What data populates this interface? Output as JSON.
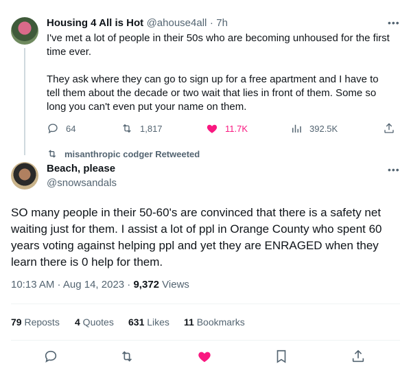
{
  "tweet1": {
    "display_name": "Housing 4 All is Hot",
    "handle": "@ahouse4all",
    "separator": "·",
    "time": "7h",
    "paragraph1": "I've met a lot of people in their 50s who are becoming unhoused for the first time ever.",
    "paragraph2": "They ask where they can go to sign up for a free apartment and I have to tell them about the decade or two wait that lies in front of them. Some so long you can't even put your name on them.",
    "replies": "64",
    "retweets": "1,817",
    "likes": "11.7K",
    "views": "392.5K"
  },
  "retweet_banner": {
    "text": "misanthropic codger Retweeted"
  },
  "tweet2": {
    "display_name": "Beach, please",
    "handle": "@snowsandals",
    "body": "SO many people in their 50-60's are convinced that there is a safety net waiting just for them. I assist a lot of ppl in Orange County who spent 60 years voting against helping ppl and yet they are ENRAGED when they learn there is 0 help for them.",
    "timestamp": "10:13 AM · Aug 14, 2023 · ",
    "views_count": "9,372",
    "views_label": " Views",
    "reposts_count": "79",
    "reposts_label": " Reposts",
    "quotes_count": "4",
    "quotes_label": " Quotes",
    "likes_count": "631",
    "likes_label": " Likes",
    "bookmarks_count": "11",
    "bookmarks_label": " Bookmarks"
  },
  "colors": {
    "like": "#f91880",
    "muted": "#536471",
    "divider": "#eff3f4"
  },
  "icons": [
    "reply-icon",
    "retweet-icon",
    "heart-icon",
    "views-icon",
    "share-icon",
    "bookmark-icon",
    "more-icon"
  ]
}
